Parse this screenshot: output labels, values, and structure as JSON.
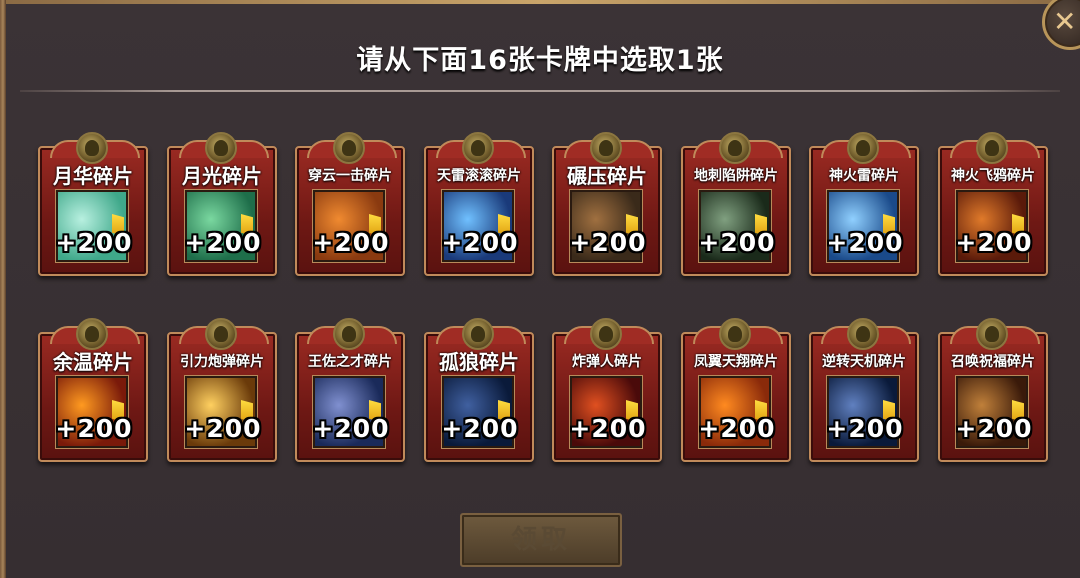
{
  "dialog": {
    "title": "请从下面16张卡牌中选取1张",
    "close_glyph": "✕",
    "claim_label": "领取"
  },
  "cards": [
    {
      "name": "月华碎片",
      "qty": "+200",
      "icon": "moonlight-shard-icon",
      "colors": [
        "#3fa88a",
        "#b8f0e0"
      ]
    },
    {
      "name": "月光碎片",
      "qty": "+200",
      "icon": "moonbeam-shard-icon",
      "colors": [
        "#1e6e4a",
        "#7ad8a0"
      ]
    },
    {
      "name": "穿云一击碎片",
      "qty": "+200",
      "icon": "cloud-strike-shard-icon",
      "colors": [
        "#8a3a10",
        "#f08a30"
      ]
    },
    {
      "name": "天雷滚滚碎片",
      "qty": "+200",
      "icon": "thunder-roll-shard-icon",
      "colors": [
        "#1a3a7a",
        "#70c0ff"
      ]
    },
    {
      "name": "碾压碎片",
      "qty": "+200",
      "icon": "crush-shard-icon",
      "colors": [
        "#3a2a1a",
        "#a07040"
      ]
    },
    {
      "name": "地刺陷阱碎片",
      "qty": "+200",
      "icon": "ground-spike-trap-shard-icon",
      "colors": [
        "#1a2a1a",
        "#80a080"
      ]
    },
    {
      "name": "神火雷碎片",
      "qty": "+200",
      "icon": "divine-fire-thunder-shard-icon",
      "colors": [
        "#1a4a8a",
        "#90d0ff"
      ]
    },
    {
      "name": "神火飞鸦碎片",
      "qty": "+200",
      "icon": "fire-crow-shard-icon",
      "colors": [
        "#5a1a0a",
        "#e07a2a"
      ]
    },
    {
      "name": "余温碎片",
      "qty": "+200",
      "icon": "afterglow-shard-icon",
      "colors": [
        "#7a1a0a",
        "#ff9a20"
      ]
    },
    {
      "name": "引力炮弹碎片",
      "qty": "+200",
      "icon": "gravity-cannonball-shard-icon",
      "colors": [
        "#6a3a0a",
        "#ffd060"
      ]
    },
    {
      "name": "王佐之才碎片",
      "qty": "+200",
      "icon": "royal-advisor-shard-icon",
      "colors": [
        "#1a2a5a",
        "#8090d0"
      ]
    },
    {
      "name": "孤狼碎片",
      "qty": "+200",
      "icon": "lone-wolf-shard-icon",
      "colors": [
        "#0a1a3a",
        "#4060a0"
      ]
    },
    {
      "name": "炸弹人碎片",
      "qty": "+200",
      "icon": "bomber-shard-icon",
      "colors": [
        "#4a0a0a",
        "#e05020"
      ]
    },
    {
      "name": "凤翼天翔碎片",
      "qty": "+200",
      "icon": "phoenix-wing-shard-icon",
      "colors": [
        "#8a2a0a",
        "#ff8a20"
      ]
    },
    {
      "name": "逆转天机碎片",
      "qty": "+200",
      "icon": "reverse-fate-shard-icon",
      "colors": [
        "#0a1a3a",
        "#6080c0"
      ]
    },
    {
      "name": "召唤祝福碎片",
      "qty": "+200",
      "icon": "summon-blessing-shard-icon",
      "colors": [
        "#3a1a0a",
        "#c0803a"
      ]
    }
  ]
}
